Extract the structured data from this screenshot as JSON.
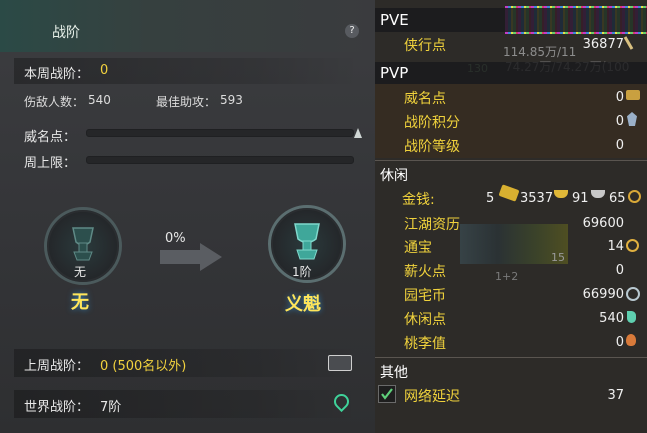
{
  "left_panel": {
    "title": "战阶",
    "help": "?",
    "this_week_label": "本周战阶：",
    "this_week_value": "0",
    "defeated_label": "伤敌人数：",
    "defeated_value": "540",
    "best_assist_label": "最佳助攻：",
    "best_assist_value": "593",
    "fame_label": "威名点：",
    "weekly_cap_label": "周上限：",
    "current_rank": {
      "rank": "无",
      "name": "无"
    },
    "progress": "0%",
    "next_rank": {
      "rank": "1阶",
      "name": "义魁"
    },
    "last_week_label": "上周战阶：",
    "last_week_value": "0 (500名以外)",
    "world_rank_label": "世界战阶：",
    "world_rank_value": "7阶"
  },
  "right_panel": {
    "pve": {
      "header": "PVE",
      "items": [
        {
          "label": "侠行点",
          "value": "36877"
        }
      ]
    },
    "pvp": {
      "header": "PVP",
      "items": [
        {
          "label": "威名点",
          "value": "0"
        },
        {
          "label": "战阶积分",
          "value": "0"
        },
        {
          "label": "战阶等级",
          "value": "0"
        }
      ]
    },
    "leisure": {
      "header": "休闲",
      "money_label": "金钱:",
      "money": {
        "gold_bar": "5",
        "gold": "3537",
        "silver": "91",
        "copper": "65"
      },
      "items": [
        {
          "label": "江湖资历",
          "value": "69600"
        },
        {
          "label": "通宝",
          "value": "14"
        },
        {
          "label": "薪火点",
          "value": "0"
        },
        {
          "label": "园宅币",
          "value": "66990"
        },
        {
          "label": "休闲点",
          "value": "540"
        },
        {
          "label": "桃李值",
          "value": "0"
        }
      ]
    },
    "other": {
      "header": "其他",
      "items": [
        {
          "label": "网络延迟",
          "value": "37",
          "checked": true
        }
      ]
    }
  },
  "background_overlay": {
    "hp_text": "114.85万/11",
    "mp_text": "74.27万/74.27万(100",
    "level": "130",
    "slot_number": "15",
    "hotkey": "1+2"
  },
  "colors": {
    "gold": "#f2d23e",
    "header_white": "#ffffff",
    "panel_dark": "#2d2b28"
  }
}
